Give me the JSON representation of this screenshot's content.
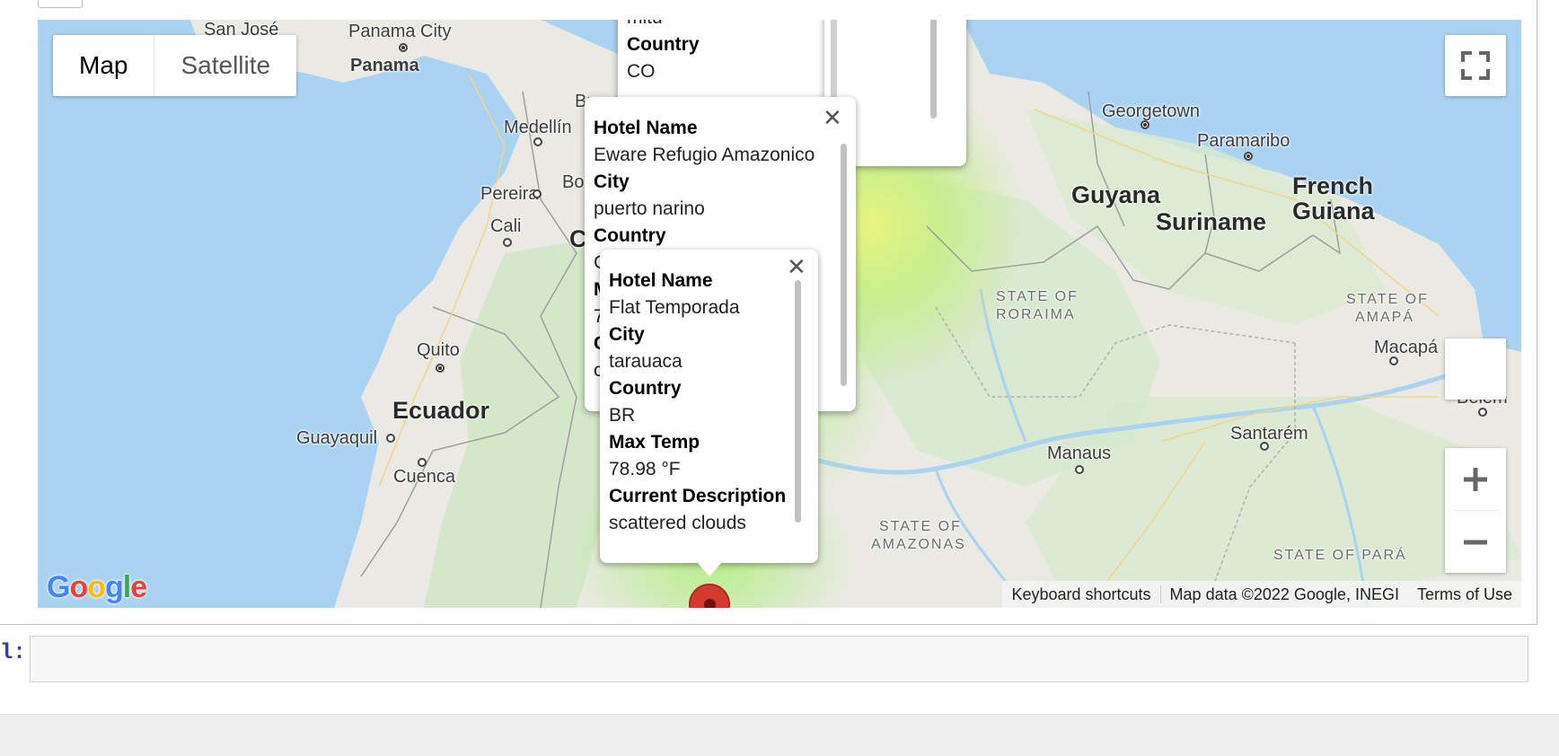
{
  "map": {
    "type_controls": {
      "map_label": "Map",
      "satellite_label": "Satellite",
      "active": "Map"
    },
    "icons": {
      "fullscreen": "fullscreen-icon",
      "zoom_in": "plus-icon",
      "zoom_out": "minus-icon",
      "close": "close-icon",
      "marker": "map-marker-icon"
    },
    "colors": {
      "water": "#aad3f2",
      "land": "#eae9e3",
      "forest": "#cfe6c6",
      "heat_green": "#b5ec82",
      "heat_yellow": "#e6f57e",
      "marker": "#d23b2f"
    },
    "places": {
      "san_jose": "San José",
      "panama_city": "Panama City",
      "panama": "Panama",
      "medellin": "Medellín",
      "pereira": "Pereira",
      "cali": "Cali",
      "quito": "Quito",
      "ecuador": "Ecuador",
      "guayaquil": "Guayaquil",
      "cuenca": "Cuenca",
      "georgetown": "Georgetown",
      "paramaribo": "Paramaribo",
      "guyana": "Guyana",
      "suriname": "Suriname",
      "french_guiana_1": "French",
      "french_guiana_2": "Guiana",
      "roraima_1": "STATE OF",
      "roraima_2": "RORAIMA",
      "amapa_1": "STATE OF",
      "amapa_2": "AMAPÁ",
      "macapa": "Macapá",
      "belem": "Belém",
      "manaus": "Manaus",
      "santarem": "Santarém",
      "amazonas_1": "STATE OF",
      "amazonas_2": "AMAZONAS",
      "para": "STATE OF PARÁ",
      "buc": "Buca",
      "bo": "Bo",
      "co_c": "C"
    },
    "infowindows": [
      {
        "partial_labels": [
          "mitu",
          "Country",
          "CO"
        ]
      },
      {
        "fields": [
          {
            "label": "Hotel Name",
            "value": "Eware Refugio Amazonico"
          },
          {
            "label": "City",
            "value": "puerto narino"
          },
          {
            "label": "Country",
            "value": "C"
          },
          {
            "label": "M",
            "value": "7"
          },
          {
            "label": "C",
            "value": "c"
          }
        ]
      },
      {
        "fields": [
          {
            "label": "Hotel Name",
            "value": "Flat Temporada"
          },
          {
            "label": "City",
            "value": "tarauaca"
          },
          {
            "label": "Country",
            "value": "BR"
          },
          {
            "label": "Max Temp",
            "value": "78.98 °F"
          },
          {
            "label": "Current Description",
            "value": "scattered clouds"
          }
        ]
      }
    ],
    "logo": [
      "G",
      "o",
      "o",
      "g",
      "l",
      "e"
    ],
    "attribution": {
      "shortcuts": "Keyboard shortcuts",
      "data": "Map data ©2022 Google, INEGI",
      "terms": "Terms of Use"
    }
  },
  "input": {
    "prompt": "l:",
    "value": ""
  }
}
